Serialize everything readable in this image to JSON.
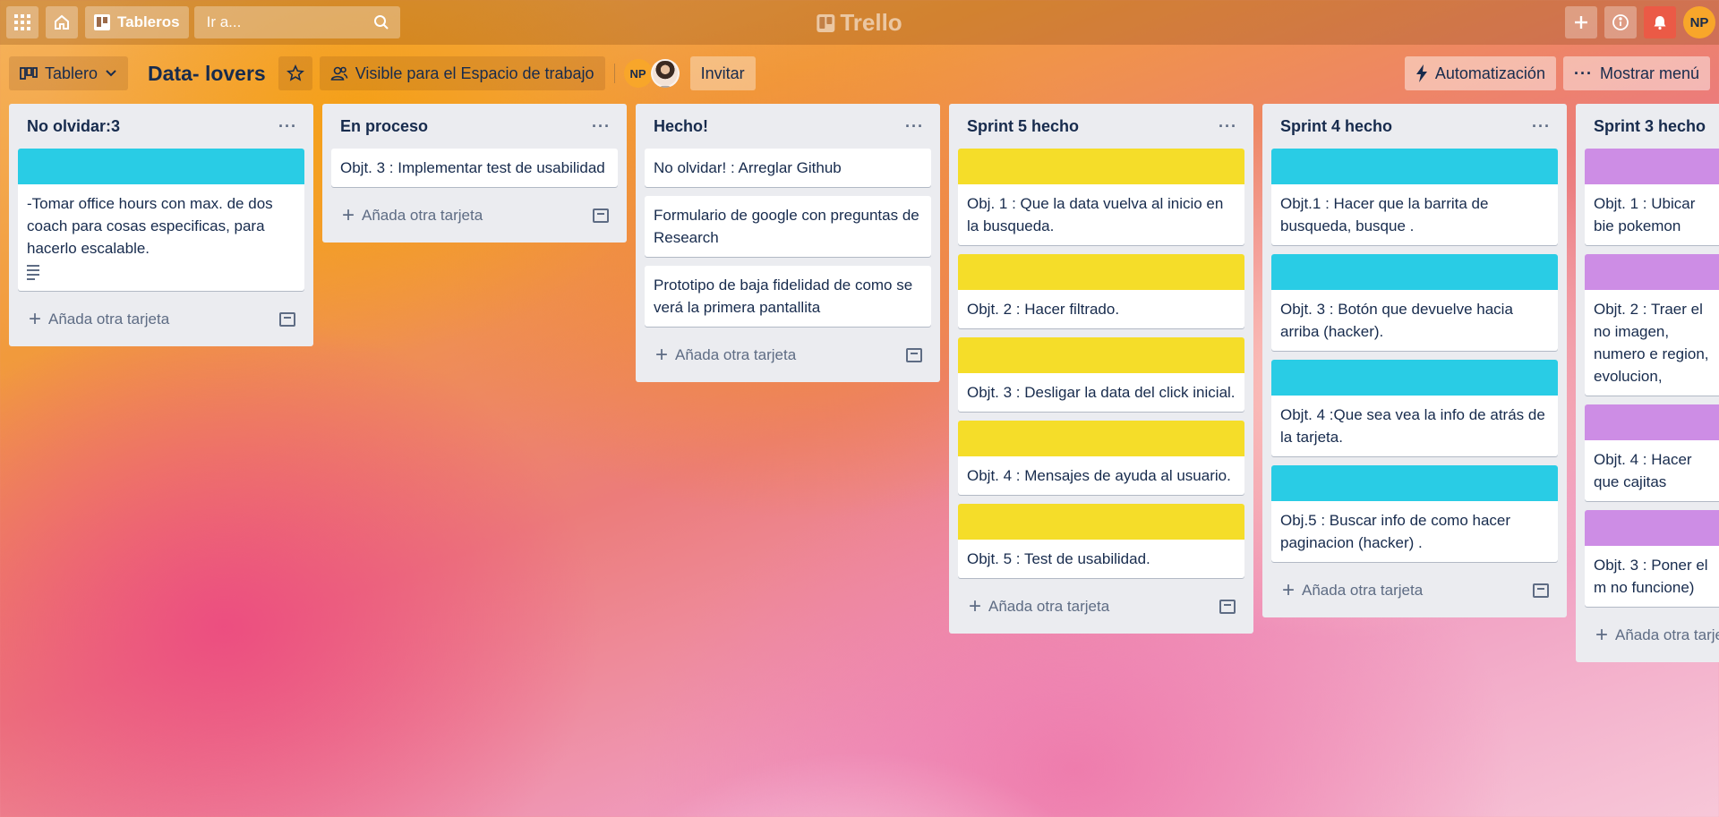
{
  "topbar": {
    "boards_label": "Tableros",
    "search_placeholder": "Ir a...",
    "logo_text": "Trello",
    "user_initials": "NP"
  },
  "boardbar": {
    "view_label": "Tablero",
    "board_title": "Data- lovers",
    "visibility_label": "Visible para el Espacio de trabajo",
    "member_initials": "NP",
    "invite_label": "Invitar",
    "automation_label": "Automatización",
    "menu_label": "Mostrar menú"
  },
  "add_card_label": "Añada otra tarjeta",
  "colors": {
    "cyan_cover": "#29cce5",
    "yellow_cover": "#f5dd29",
    "purple_cover": "#cd8de5",
    "bell_red": "#eb5a46",
    "avatar_orange": "#f8a62a"
  },
  "lists": [
    {
      "title": "No olvidar:3",
      "cards": [
        {
          "cover": "cyan",
          "text": "-Tomar office hours con max. de dos coach para cosas especificas, para hacerlo escalable.",
          "has_description": true
        }
      ]
    },
    {
      "title": "En proceso",
      "cards": [
        {
          "cover": null,
          "text": "Objt. 3 : Implementar test de usabilidad"
        }
      ]
    },
    {
      "title": "Hecho!",
      "cards": [
        {
          "cover": null,
          "text": "No olvidar! : Arreglar Github"
        },
        {
          "cover": null,
          "text": "Formulario de google con preguntas de Research"
        },
        {
          "cover": null,
          "text": "Prototipo de baja fidelidad de como se verá la primera pantallita"
        }
      ]
    },
    {
      "title": "Sprint 5 hecho",
      "cards": [
        {
          "cover": "yellow",
          "text": "Obj. 1 : Que la data vuelva al inicio en la busqueda."
        },
        {
          "cover": "yellow",
          "text": "Objt. 2 : Hacer filtrado."
        },
        {
          "cover": "yellow",
          "text": "Objt. 3 : Desligar la data del click inicial."
        },
        {
          "cover": "yellow",
          "text": "Objt. 4 : Mensajes de ayuda al usuario."
        },
        {
          "cover": "yellow",
          "text": "Objt. 5 : Test de usabilidad."
        }
      ]
    },
    {
      "title": "Sprint 4 hecho",
      "cards": [
        {
          "cover": "cyan",
          "text": "Objt.1 : Hacer que la barrita de busqueda, busque ."
        },
        {
          "cover": "cyan",
          "text": "Objt. 3 : Botón que devuelve hacia arriba (hacker)."
        },
        {
          "cover": "cyan",
          "text": "Objt. 4 :Que sea vea la info de atrás de la tarjeta."
        },
        {
          "cover": "cyan",
          "text": "Obj.5 : Buscar info de como hacer paginacion (hacker) ."
        }
      ]
    },
    {
      "title": "Sprint 3 hecho",
      "cards": [
        {
          "cover": "purple",
          "text": "Objt. 1 : Ubicar bie pokemon"
        },
        {
          "cover": "purple",
          "text": "Objt. 2 : Traer el no imagen, numero e region, evolucion,"
        },
        {
          "cover": "purple",
          "text": "Objt. 4 : Hacer que cajitas"
        },
        {
          "cover": "purple",
          "text": "Objt. 3 : Poner el m no funcione)"
        }
      ]
    }
  ]
}
